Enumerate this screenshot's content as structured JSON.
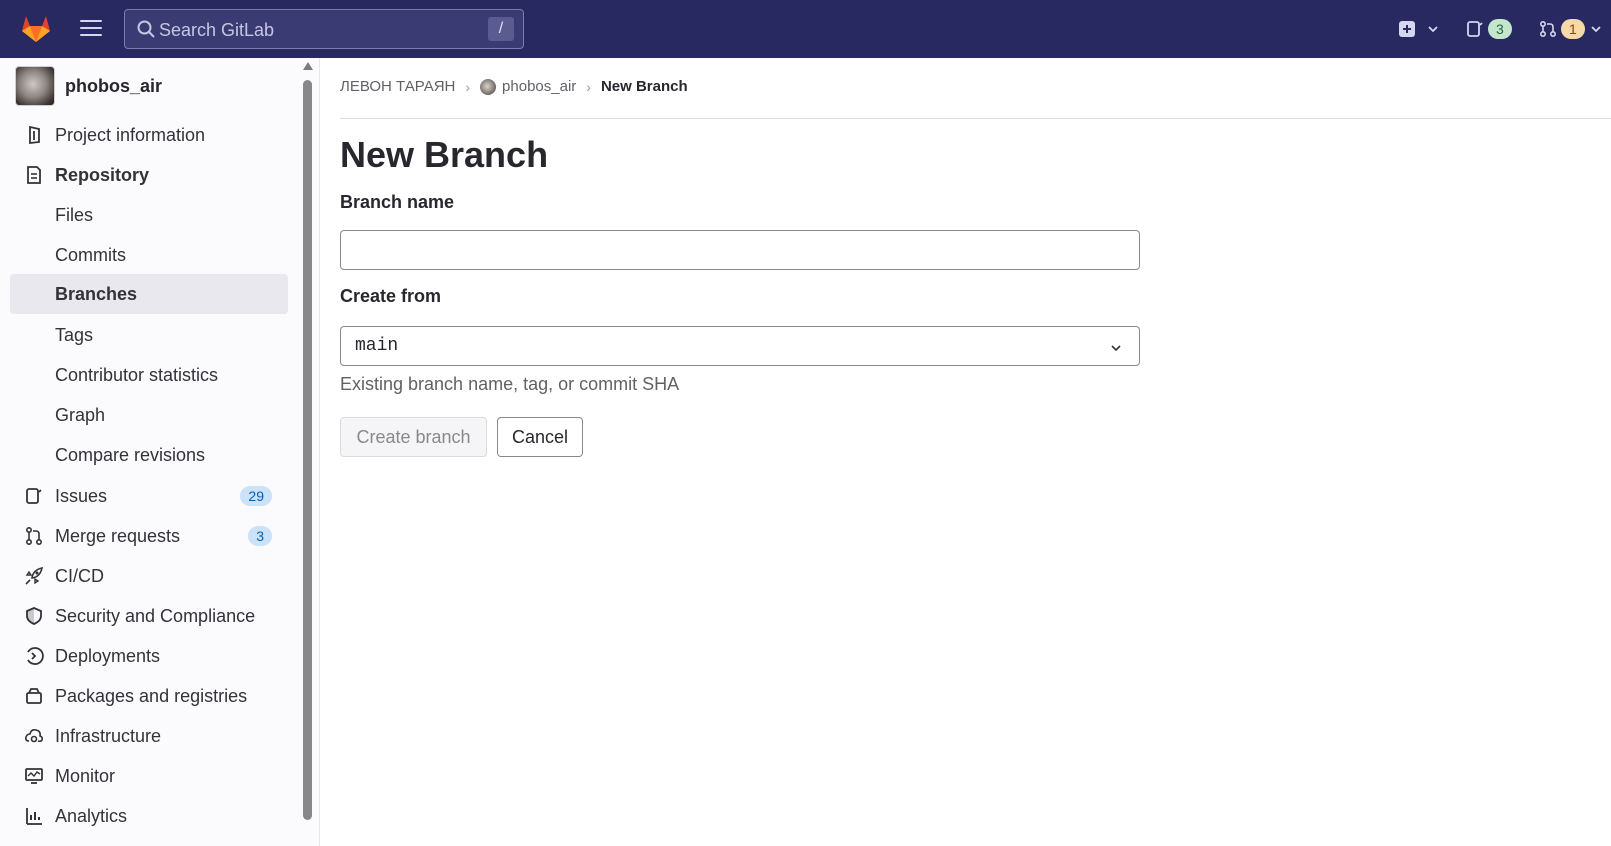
{
  "topbar": {
    "search_placeholder": "Search GitLab",
    "search_shortcut": "/",
    "issues_count": "3",
    "merge_requests_count": "1",
    "colors": {
      "background": "#292961",
      "issues_pill": "#c3e6cd",
      "mr_pill": "#f5d9a8"
    }
  },
  "sidebar": {
    "project_name": "phobos_air",
    "items": [
      {
        "label": "Project information",
        "icon": "project-info-icon"
      },
      {
        "label": "Repository",
        "icon": "repository-icon"
      },
      {
        "label": "Files"
      },
      {
        "label": "Commits"
      },
      {
        "label": "Branches"
      },
      {
        "label": "Tags"
      },
      {
        "label": "Contributor statistics"
      },
      {
        "label": "Graph"
      },
      {
        "label": "Compare revisions"
      },
      {
        "label": "Issues",
        "icon": "issues-icon",
        "badge": "29"
      },
      {
        "label": "Merge requests",
        "icon": "merge-request-icon",
        "badge": "3"
      },
      {
        "label": "CI/CD",
        "icon": "rocket-icon"
      },
      {
        "label": "Security and Compliance",
        "icon": "shield-icon"
      },
      {
        "label": "Deployments",
        "icon": "deployments-icon"
      },
      {
        "label": "Packages and registries",
        "icon": "package-icon"
      },
      {
        "label": "Infrastructure",
        "icon": "cloud-gear-icon"
      },
      {
        "label": "Monitor",
        "icon": "monitor-icon"
      },
      {
        "label": "Analytics",
        "icon": "chart-icon"
      }
    ]
  },
  "breadcrumb": {
    "owner": "ЛЕВОН ТАРАЯН",
    "project": "phobos_air",
    "current": "New Branch"
  },
  "form": {
    "title": "New Branch",
    "branch_name_label": "Branch name",
    "branch_name_value": "",
    "create_from_label": "Create from",
    "create_from_value": "main",
    "help_text": "Existing branch name, tag, or commit SHA",
    "create_button": "Create branch",
    "cancel_button": "Cancel"
  }
}
